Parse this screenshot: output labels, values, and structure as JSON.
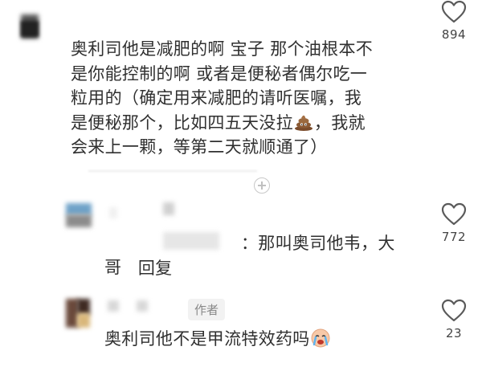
{
  "comments": [
    {
      "text_before_emoji": "奥利司他是减肥的啊 宝子 那个油根本不\n是你能控制的啊 或者是便秘者偶尔吃一\n粒用的（确定用来减肥的请听医嘱，我\n是便秘那个，比如四五天没拉",
      "emoji": "poop-emoji",
      "text_after_emoji": "，我就\n会来上一颗，等第二天就顺通了）",
      "like_count": "894"
    },
    {
      "reply_prefix": "回复",
      "reply_text_line1": "：那叫奥司他韦，大",
      "reply_text_line2": "哥",
      "like_count": "772"
    },
    {
      "author_badge": "作者",
      "text": "奥利司他不是甲流特效药吗",
      "emoji": "crying-face-emoji",
      "like_count": "23"
    }
  ],
  "colors": {
    "text": "#303030",
    "count": "#444444",
    "badge_bg": "#f2f2f2",
    "badge_text": "#888888"
  }
}
